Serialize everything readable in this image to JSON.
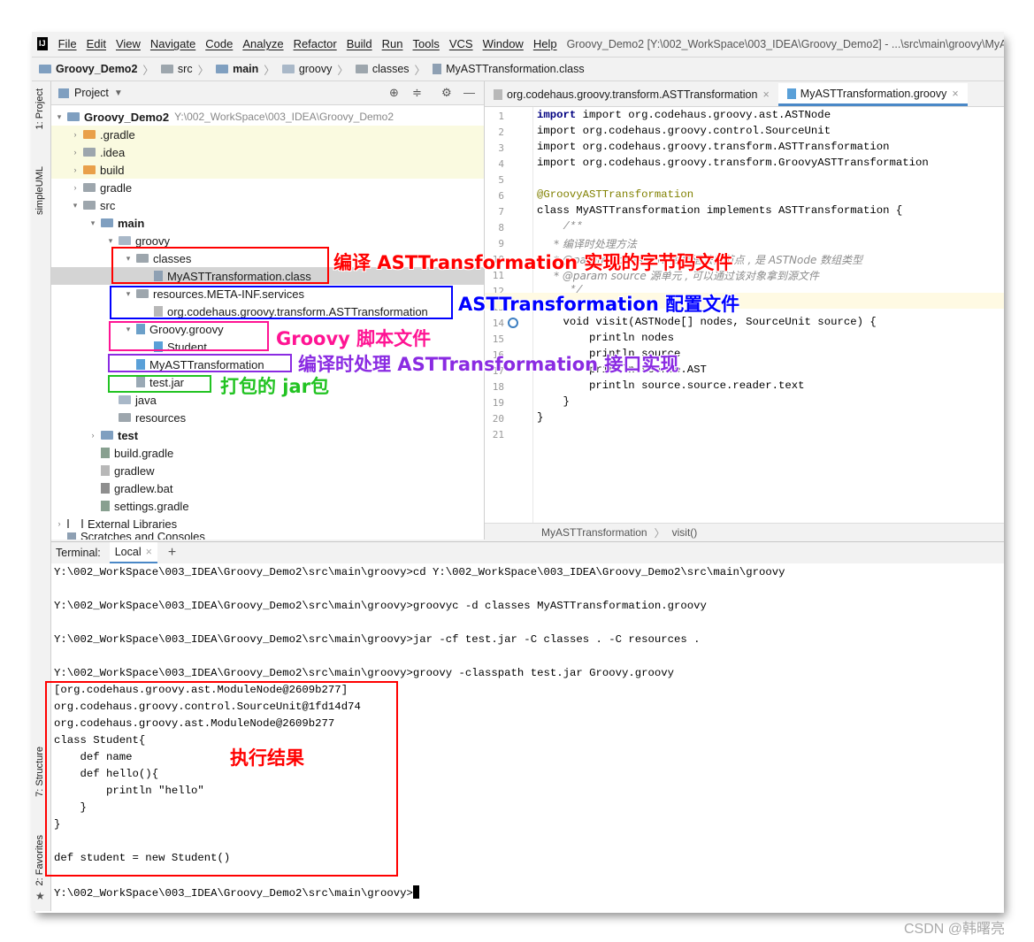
{
  "menu": {
    "logo": "IJ",
    "items": [
      "File",
      "Edit",
      "View",
      "Navigate",
      "Code",
      "Analyze",
      "Refactor",
      "Build",
      "Run",
      "Tools",
      "VCS",
      "Window",
      "Help"
    ],
    "window_title": "Groovy_Demo2 [Y:\\002_WorkSpace\\003_IDEA\\Groovy_Demo2] - ...\\src\\main\\groovy\\MyASTTransformation.groovy"
  },
  "breadcrumb": [
    "Groovy_Demo2",
    "src",
    "main",
    "groovy",
    "classes",
    "MyASTTransformation.class"
  ],
  "left_tabs": {
    "project": "1: Project",
    "simpleuml": "simpleUML",
    "structure": "7: Structure",
    "favorites": "2: Favorites"
  },
  "project_panel": {
    "title": "Project",
    "root_name": "Groovy_Demo2",
    "root_path": "Y:\\002_WorkSpace\\003_IDEA\\Groovy_Demo2",
    "tree": [
      ".gradle",
      ".idea",
      "build",
      "gradle",
      "src",
      "main",
      "groovy",
      "classes",
      "MyASTTransformation.class",
      "resources.META-INF.services",
      "org.codehaus.groovy.transform.ASTTransformation",
      "Groovy.groovy",
      "Student",
      "MyASTTransformation",
      "test.jar",
      "java",
      "resources",
      "test",
      "build.gradle",
      "gradlew",
      "gradlew.bat",
      "settings.gradle",
      "External Libraries",
      "Scratches and Consoles"
    ]
  },
  "editor": {
    "tabs": [
      "org.codehaus.groovy.transform.ASTTransformation",
      "MyASTTransformation.groovy"
    ],
    "line_numbers": [
      "1",
      "2",
      "3",
      "4",
      "5",
      "6",
      "7",
      "8",
      "9",
      "10",
      "11",
      "12",
      "13",
      "14",
      "15",
      "16",
      "17",
      "18",
      "19",
      "20",
      "21"
    ],
    "lines": {
      "l1": "import org.codehaus.groovy.ast.ASTNode",
      "l2": "import org.codehaus.groovy.control.SourceUnit",
      "l3": "import org.codehaus.groovy.transform.ASTTransformation",
      "l4": "import org.codehaus.groovy.transform.GroovyASTTransformation",
      "l6": "@GroovyASTTransformation",
      "l7": "class MyASTTransformation implements ASTTransformation {",
      "l8": "    /**",
      "l9": "     * 编译时处理方法",
      "l10": "     * @param nodes AST 抽象语法树节点 , 是 ASTNode 数组类型",
      "l11": "     * @param source 源单元 , 可以通过该对象拿到源文件",
      "l12": "     */",
      "l14": "    void visit(ASTNode[] nodes, SourceUnit source) {",
      "l15": "        println nodes",
      "l16": "        println source",
      "l17": "        println source.AST",
      "l18": "        println source.source.reader.text",
      "l19": "    }",
      "l20": "}"
    },
    "status_class": "MyASTTransformation",
    "status_method": "visit()"
  },
  "terminal": {
    "tab_title": "Terminal:",
    "tab_local": "Local",
    "lines": [
      "Y:\\002_WorkSpace\\003_IDEA\\Groovy_Demo2\\src\\main\\groovy>cd Y:\\002_WorkSpace\\003_IDEA\\Groovy_Demo2\\src\\main\\groovy",
      "Y:\\002_WorkSpace\\003_IDEA\\Groovy_Demo2\\src\\main\\groovy>groovyc -d classes MyASTTransformation.groovy",
      "Y:\\002_WorkSpace\\003_IDEA\\Groovy_Demo2\\src\\main\\groovy>jar -cf test.jar -C classes . -C resources .",
      "Y:\\002_WorkSpace\\003_IDEA\\Groovy_Demo2\\src\\main\\groovy>groovy -classpath test.jar Groovy.groovy",
      "[org.codehaus.groovy.ast.ModuleNode@2609b277]",
      "org.codehaus.groovy.control.SourceUnit@1fd14d74",
      "org.codehaus.groovy.ast.ModuleNode@2609b277",
      "class Student{",
      "    def name",
      "    def hello(){",
      "        println \"hello\"",
      "    }",
      "}",
      "def student = new Student()",
      "Y:\\002_WorkSpace\\003_IDEA\\Groovy_Demo2\\src\\main\\groovy>"
    ]
  },
  "annotations": {
    "classes": {
      "text": "编译 ASTTransformation 实现的字节码文件",
      "color": "#ff0000"
    },
    "config": {
      "text": "ASTTransformation 配置文件",
      "color": "#0000ff"
    },
    "script": {
      "text": "Groovy 脚本文件",
      "color": "#ff1493"
    },
    "impl": {
      "text": "编译时处理 ASTTransformation 接口实现",
      "color": "#8a2be2"
    },
    "jar": {
      "text": "打包的 jar包",
      "color": "#22c322"
    },
    "result": {
      "text": "执行结果",
      "color": "#ff0000"
    }
  },
  "watermark": "CSDN @韩曙亮"
}
